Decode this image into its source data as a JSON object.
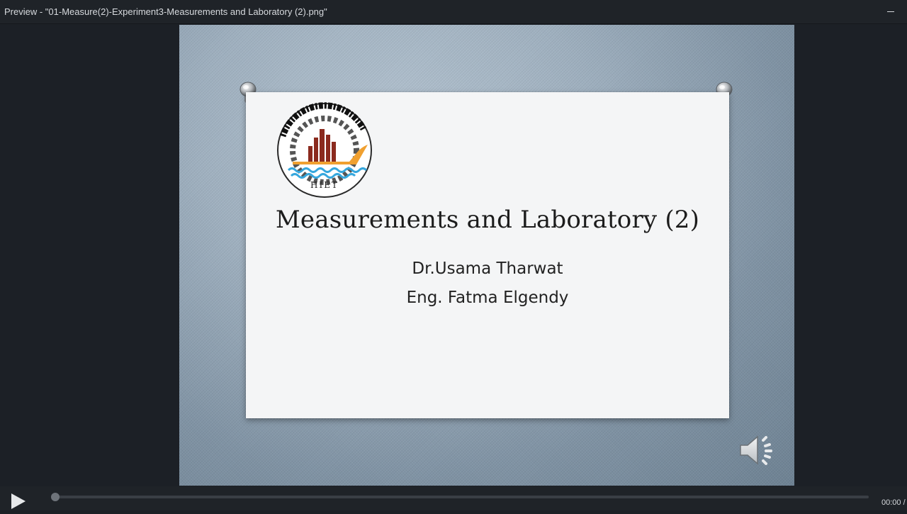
{
  "window": {
    "title": "Preview - \"01-Measure(2)-Experiment3-Measurements and Laboratory (2).png\""
  },
  "slide": {
    "title": "Measurements and Laboratory (2)",
    "authors": [
      "Dr.Usama Tharwat",
      "Eng. Fatma Elgendy"
    ],
    "logo": {
      "arabic_text": "المعهد العالي للهندسة والتكنولوجيا بكفر الشيخ",
      "english_text": "Higher Institute of Engineering and Technology Kafr El-Sheikh",
      "abbreviation": "HIET"
    }
  },
  "player": {
    "time": "00:00 /",
    "progress": 0.0,
    "icons": [
      "play-icon",
      "speaker-icon",
      "minimize-icon"
    ]
  },
  "colors": {
    "chrome": "#1f2328",
    "logo_red": "#8b2a1e",
    "logo_orange": "#f0a030",
    "logo_blue": "#36a7dd"
  }
}
